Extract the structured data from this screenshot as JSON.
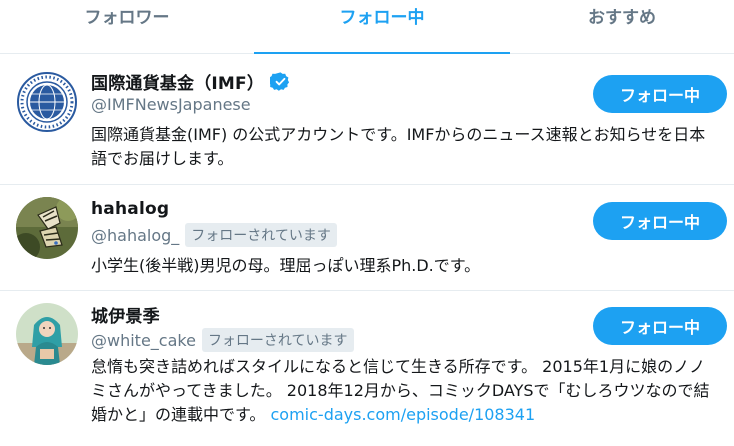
{
  "tabs": [
    {
      "label": "フォロワー"
    },
    {
      "label": "フォロー中"
    },
    {
      "label": "おすすめ"
    }
  ],
  "active_tab": 1,
  "colors": {
    "accent": "#1da1f2",
    "text": "#14171a",
    "muted": "#657786",
    "divider": "#e6ecf0"
  },
  "users": [
    {
      "name": "国際通貨基金（IMF）",
      "verified": true,
      "handle": "@IMFNewsJapanese",
      "follows_you": "",
      "bio": "国際通貨基金(IMF) の公式アカウントです。IMFからのニュース速報とお知らせを日本語でお届けします。",
      "bio_link": "",
      "button": "フォロー中",
      "avatar_icon": "imf-seal-icon"
    },
    {
      "name": "hahalog",
      "verified": false,
      "handle": "@hahalog_",
      "follows_you": "フォローされています",
      "bio": "小学生(後半戦)男児の母。理屈っぽい理系Ph.D.です。",
      "bio_link": "",
      "button": "フォロー中",
      "avatar_icon": "butterfly-photo-icon"
    },
    {
      "name": "城伊景季",
      "verified": false,
      "handle": "@white_cake",
      "follows_you": "フォローされています",
      "bio": "怠惰も突き詰めればスタイルになると信じて生きる所存です。 2015年1月に娘のノノミさんがやってきました。 2018年12月から、コミックDAYSで「むしろウツなので結婚かと」の連載中です。 ",
      "bio_link": "comic-days.com/episode/108341",
      "button": "フォロー中",
      "avatar_icon": "illustrated-person-icon"
    }
  ]
}
